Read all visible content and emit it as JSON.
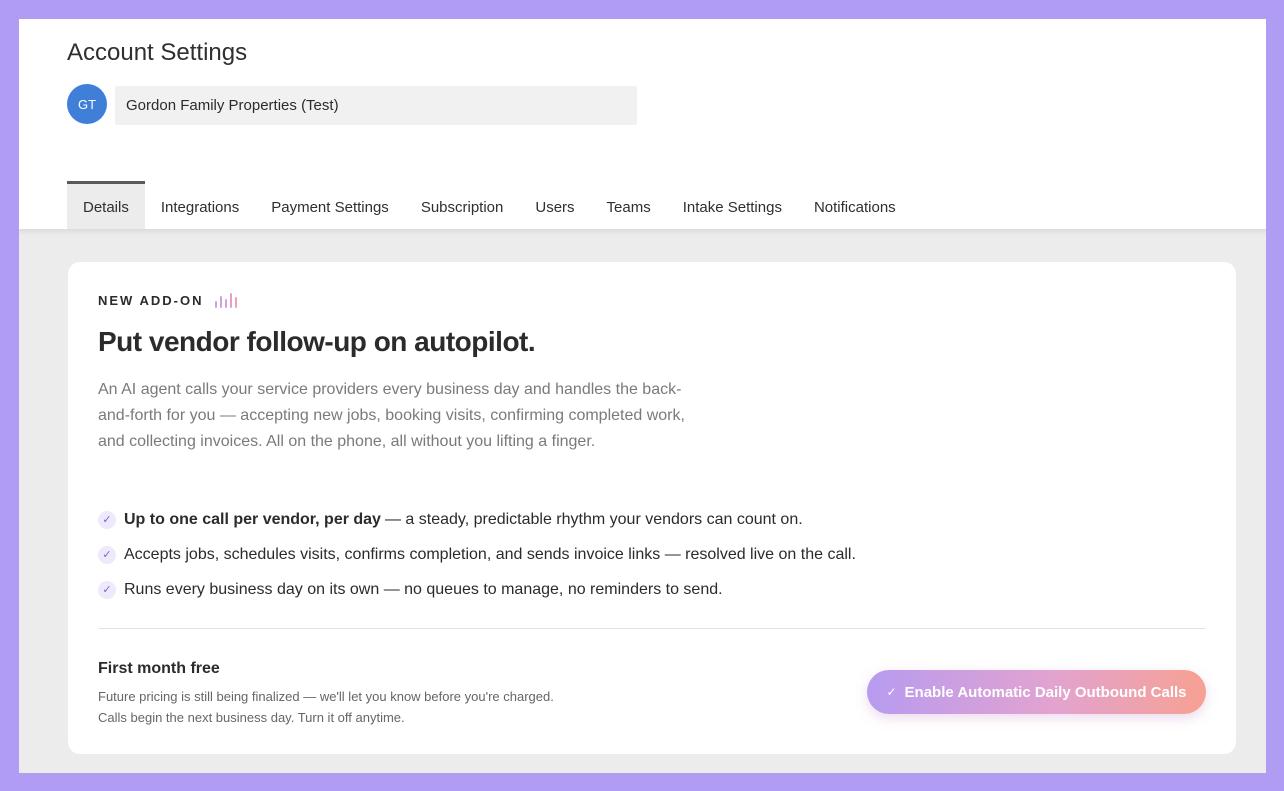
{
  "header": {
    "title": "Account Settings",
    "avatar_initials": "GT",
    "account_name": "Gordon Family Properties (Test)"
  },
  "tabs": [
    {
      "label": "Details",
      "active": true
    },
    {
      "label": "Integrations"
    },
    {
      "label": "Payment Settings"
    },
    {
      "label": "Subscription"
    },
    {
      "label": "Users"
    },
    {
      "label": "Teams"
    },
    {
      "label": "Intake Settings"
    },
    {
      "label": "Notifications"
    }
  ],
  "addon": {
    "eyebrow": "NEW ADD-ON",
    "eyebrow_icon": "sound-bars-icon",
    "headline": "Put vendor follow-up on autopilot.",
    "description": "An AI agent calls your service providers every business day and handles the back-and-forth for you — accepting new jobs, booking visits, confirming completed work, and collecting invoices. All on the phone, all without you lifting a finger.",
    "features": [
      {
        "bold": "Up to one call per vendor, per day",
        "text": "— a steady, predictable rhythm your vendors can count on."
      },
      {
        "bold": "",
        "text": "Accepts jobs, schedules visits, confirms completion, and sends invoice links — resolved live on the call."
      },
      {
        "bold": "",
        "text": "Runs every business day on its own — no queues to manage, no reminders to send."
      }
    ],
    "pricing_title": "First month free",
    "pricing_note_1": "Future pricing is still being finalized — we'll let you know before you're charged.",
    "pricing_note_2": "Calls begin the next business day. Turn it off anytime.",
    "button_label": "Enable Automatic Daily Outbound Calls"
  },
  "colors": {
    "background": "#b19cf4",
    "avatar": "#3f7fd8",
    "accent_gradient_start": "#b79bf0",
    "accent_gradient_end": "#f7a192"
  }
}
